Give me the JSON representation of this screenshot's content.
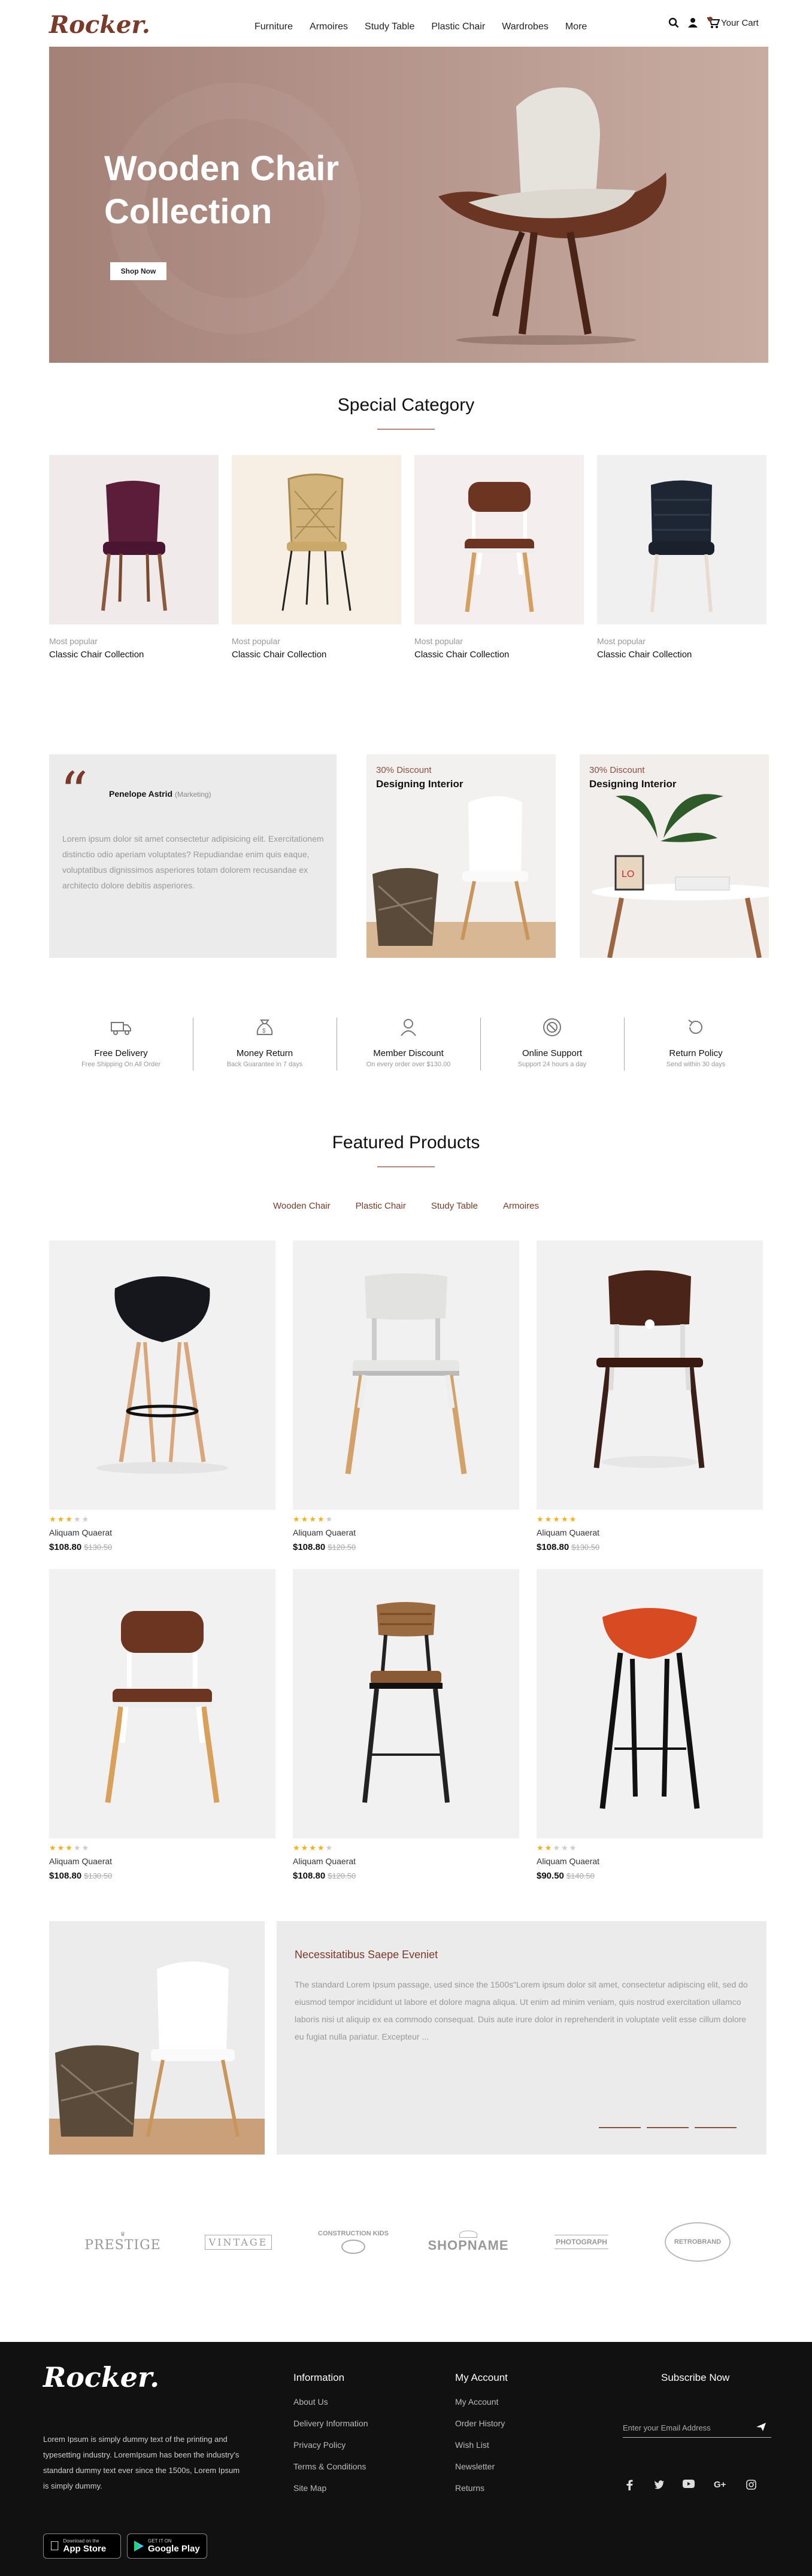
{
  "header": {
    "logo": "Rocker.",
    "nav": [
      "Furniture",
      "Armoires",
      "Study Table",
      "Plastic Chair",
      "Wardrobes",
      "More"
    ],
    "cart_label": "Your Cart",
    "icons": [
      "search-icon",
      "user-icon",
      "cart-icon"
    ]
  },
  "hero": {
    "title_line1": "Wooden Chair",
    "title_line2": "Collection",
    "button": "Shop Now"
  },
  "special_category": {
    "title": "Special Category",
    "items": [
      {
        "tag": "Most popular",
        "name": "Classic Chair Collection"
      },
      {
        "tag": "Most popular",
        "name": "Classic Chair Collection"
      },
      {
        "tag": "Most popular",
        "name": "Classic Chair Collection"
      },
      {
        "tag": "Most popular",
        "name": "Classic Chair Collection"
      }
    ]
  },
  "testimonial": {
    "name": "Penelope Astrid",
    "role": "(Marketing)",
    "text": "Lorem ipsum dolor sit amet consectetur adipisicing elit. Exercitationem distinctio odio aperiam voluptates? Repudiandae enim quis eaque, voluptatibus dignissimos asperiores totam dolorem recusandae ex architecto dolore debitis asperiores."
  },
  "promos": [
    {
      "discount": "30% Discount",
      "title": "Designing Interior"
    },
    {
      "discount": "30% Discount",
      "title": "Designing Interior"
    }
  ],
  "features": [
    {
      "title": "Free Delivery",
      "sub": "Free Shipping On All Order",
      "icon": "truck-icon"
    },
    {
      "title": "Money Return",
      "sub": "Back Guarantee in 7 days",
      "icon": "money-bag-icon"
    },
    {
      "title": "Member Discount",
      "sub": "On every order over $130.00",
      "icon": "member-icon"
    },
    {
      "title": "Online Support",
      "sub": "Support 24 hours a day",
      "icon": "support-icon"
    },
    {
      "title": "Return Policy",
      "sub": "Send within 30 days",
      "icon": "return-icon"
    }
  ],
  "featured": {
    "title": "Featured Products",
    "tabs": [
      "Wooden Chair",
      "Plastic Chair",
      "Study Table",
      "Armoires"
    ],
    "products": [
      {
        "name": "Aliquam Quaerat",
        "price": "$108.80",
        "old": "$130.50",
        "rating": 3
      },
      {
        "name": "Aliquam Quaerat",
        "price": "$108.80",
        "old": "$120.50",
        "rating": 4
      },
      {
        "name": "Aliquam Quaerat",
        "price": "$108.80",
        "old": "$130.50",
        "rating": 5
      },
      {
        "name": "Aliquam Quaerat",
        "price": "$108.80",
        "old": "$130.50",
        "rating": 3
      },
      {
        "name": "Aliquam Quaerat",
        "price": "$108.80",
        "old": "$120.50",
        "rating": 4
      },
      {
        "name": "Aliquam Quaerat",
        "price": "$90.50",
        "old": "$140.50",
        "rating": 2
      }
    ]
  },
  "blog": {
    "title": "Necessitatibus Saepe Eveniet",
    "body": "The standard Lorem Ipsum passage, used since the 1500s\"Lorem ipsum dolor sit amet, consectetur adipiscing elit, sed do eiusmod tempor incididunt ut labore et dolore magna aliqua. Ut enim ad minim veniam, quis nostrud exercitation ullamco laboris nisi ut aliquip ex ea commodo consequat. Duis aute irure dolor in reprehenderit in voluptate velit esse cillum dolore eu fugiat nulla pariatur. Excepteur ..."
  },
  "brands": [
    "PRESTIGE",
    "VINTAGE",
    "CONSTRUCTION KIDS",
    "SHOPNAME",
    "PHOTOGRAPH",
    "RETROBRAND"
  ],
  "footer": {
    "logo": "Rocker.",
    "description": "Lorem Ipsum is simply dummy text of the printing and typesetting industry. LoremIpsum has been the industry's standard dummy text ever since the 1500s, Lorem Ipsum is simply dummy.",
    "appstore_small": "Download on the",
    "appstore_big": "App Store",
    "gplay_small": "GET IT ON",
    "gplay_big": "Google Play",
    "info_title": "Information",
    "info_links": [
      "About Us",
      "Delivery Information",
      "Privacy Policy",
      "Terms & Conditions",
      "Site Map"
    ],
    "account_title": "My Account",
    "account_links": [
      "My Account",
      "Order History",
      "Wish List",
      "Newsletter",
      "Returns"
    ],
    "subscribe_title": "Subscribe Now",
    "email_placeholder": "Enter your Email Address",
    "social_icons": [
      "facebook-icon",
      "twitter-icon",
      "youtube-icon",
      "google-plus-icon",
      "instagram-icon"
    ]
  }
}
